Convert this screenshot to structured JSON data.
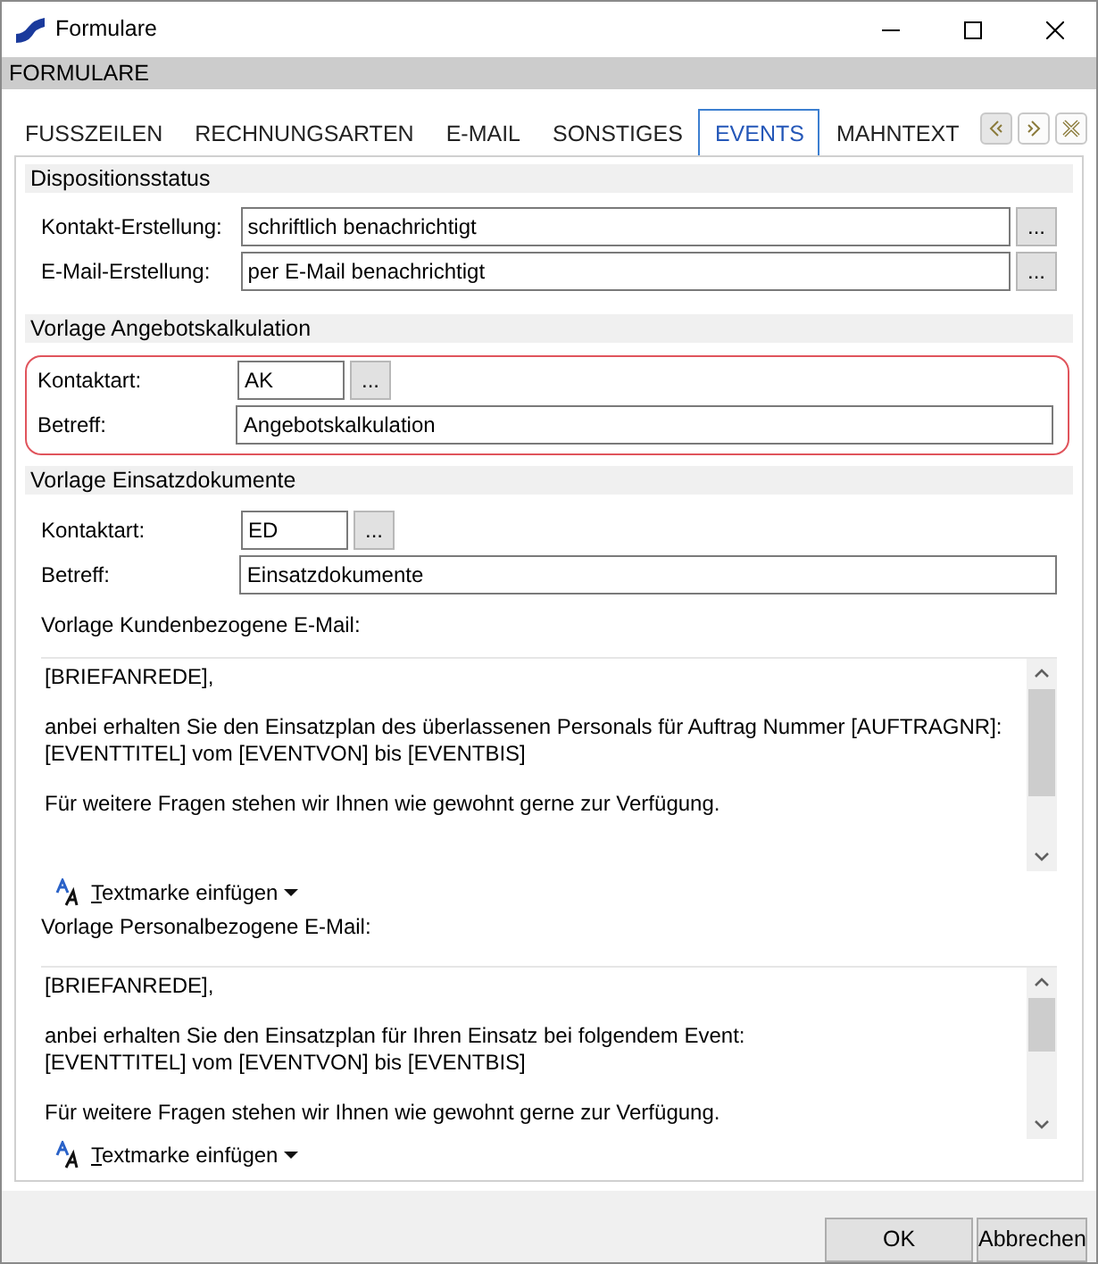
{
  "window": {
    "title": "Formulare"
  },
  "header": "FORMULARE",
  "tabs": [
    {
      "label": "FUSSZEILEN",
      "selected": false
    },
    {
      "label": "RECHNUNGSARTEN",
      "selected": false
    },
    {
      "label": "E-MAIL",
      "selected": false
    },
    {
      "label": "SONSTIGES",
      "selected": false
    },
    {
      "label": "EVENTS",
      "selected": true
    },
    {
      "label": "MAHNTEXT",
      "selected": false
    }
  ],
  "sections": [
    {
      "title": "Dispositionsstatus",
      "highlighted": false,
      "fields": [
        {
          "kind": "long",
          "label": "Kontakt-Erstellung:",
          "value": "schriftlich benachrichtigt",
          "button": "..."
        },
        {
          "kind": "long",
          "label": "E-Mail-Erstellung:",
          "value": "per E-Mail benachrichtigt",
          "button": "..."
        }
      ]
    },
    {
      "title": "Vorlage Angebotskalkulation",
      "highlighted": true,
      "fields": [
        {
          "kind": "code",
          "label": "Kontaktart:",
          "value": "AK",
          "button": "..."
        },
        {
          "kind": "text",
          "label": "Betreff:",
          "value": "Angebotskalkulation"
        }
      ]
    },
    {
      "title": "Vorlage Einsatzdokumente",
      "highlighted": false,
      "fields": [
        {
          "kind": "code",
          "label": "Kontaktart:",
          "value": "ED",
          "button": "..."
        },
        {
          "kind": "text",
          "label": "Betreff:",
          "value": "Einsatzdokumente"
        }
      ],
      "templates": [
        {
          "label": "Vorlage Kundenbezogene E-Mail:",
          "body": "[BRIEFANREDE],\n\nanbei erhalten Sie den Einsatzplan des überlassenen Personals für Auftrag Nummer [AUFTRAGNR]:\n[EVENTTITEL] vom [EVENTVON] bis [EVENTBIS]\n\nFür weitere Fragen stehen wir Ihnen wie gewohnt gerne zur Verfügung.",
          "insert_button": "Textmarke einfügen"
        },
        {
          "label": "Vorlage Personalbezogene E-Mail:",
          "body": "[BRIEFANREDE],\n\nanbei erhalten Sie den Einsatzplan für Ihren Einsatz bei folgendem Event:\n[EVENTTITEL] vom [EVENTVON] bis [EVENTBIS]\n\nFür weitere Fragen stehen wir Ihnen wie gewohnt gerne zur Verfügung.",
          "insert_button": "Textmarke einfügen"
        }
      ]
    }
  ],
  "buttons": [
    "OK",
    "Abbrechen"
  ]
}
